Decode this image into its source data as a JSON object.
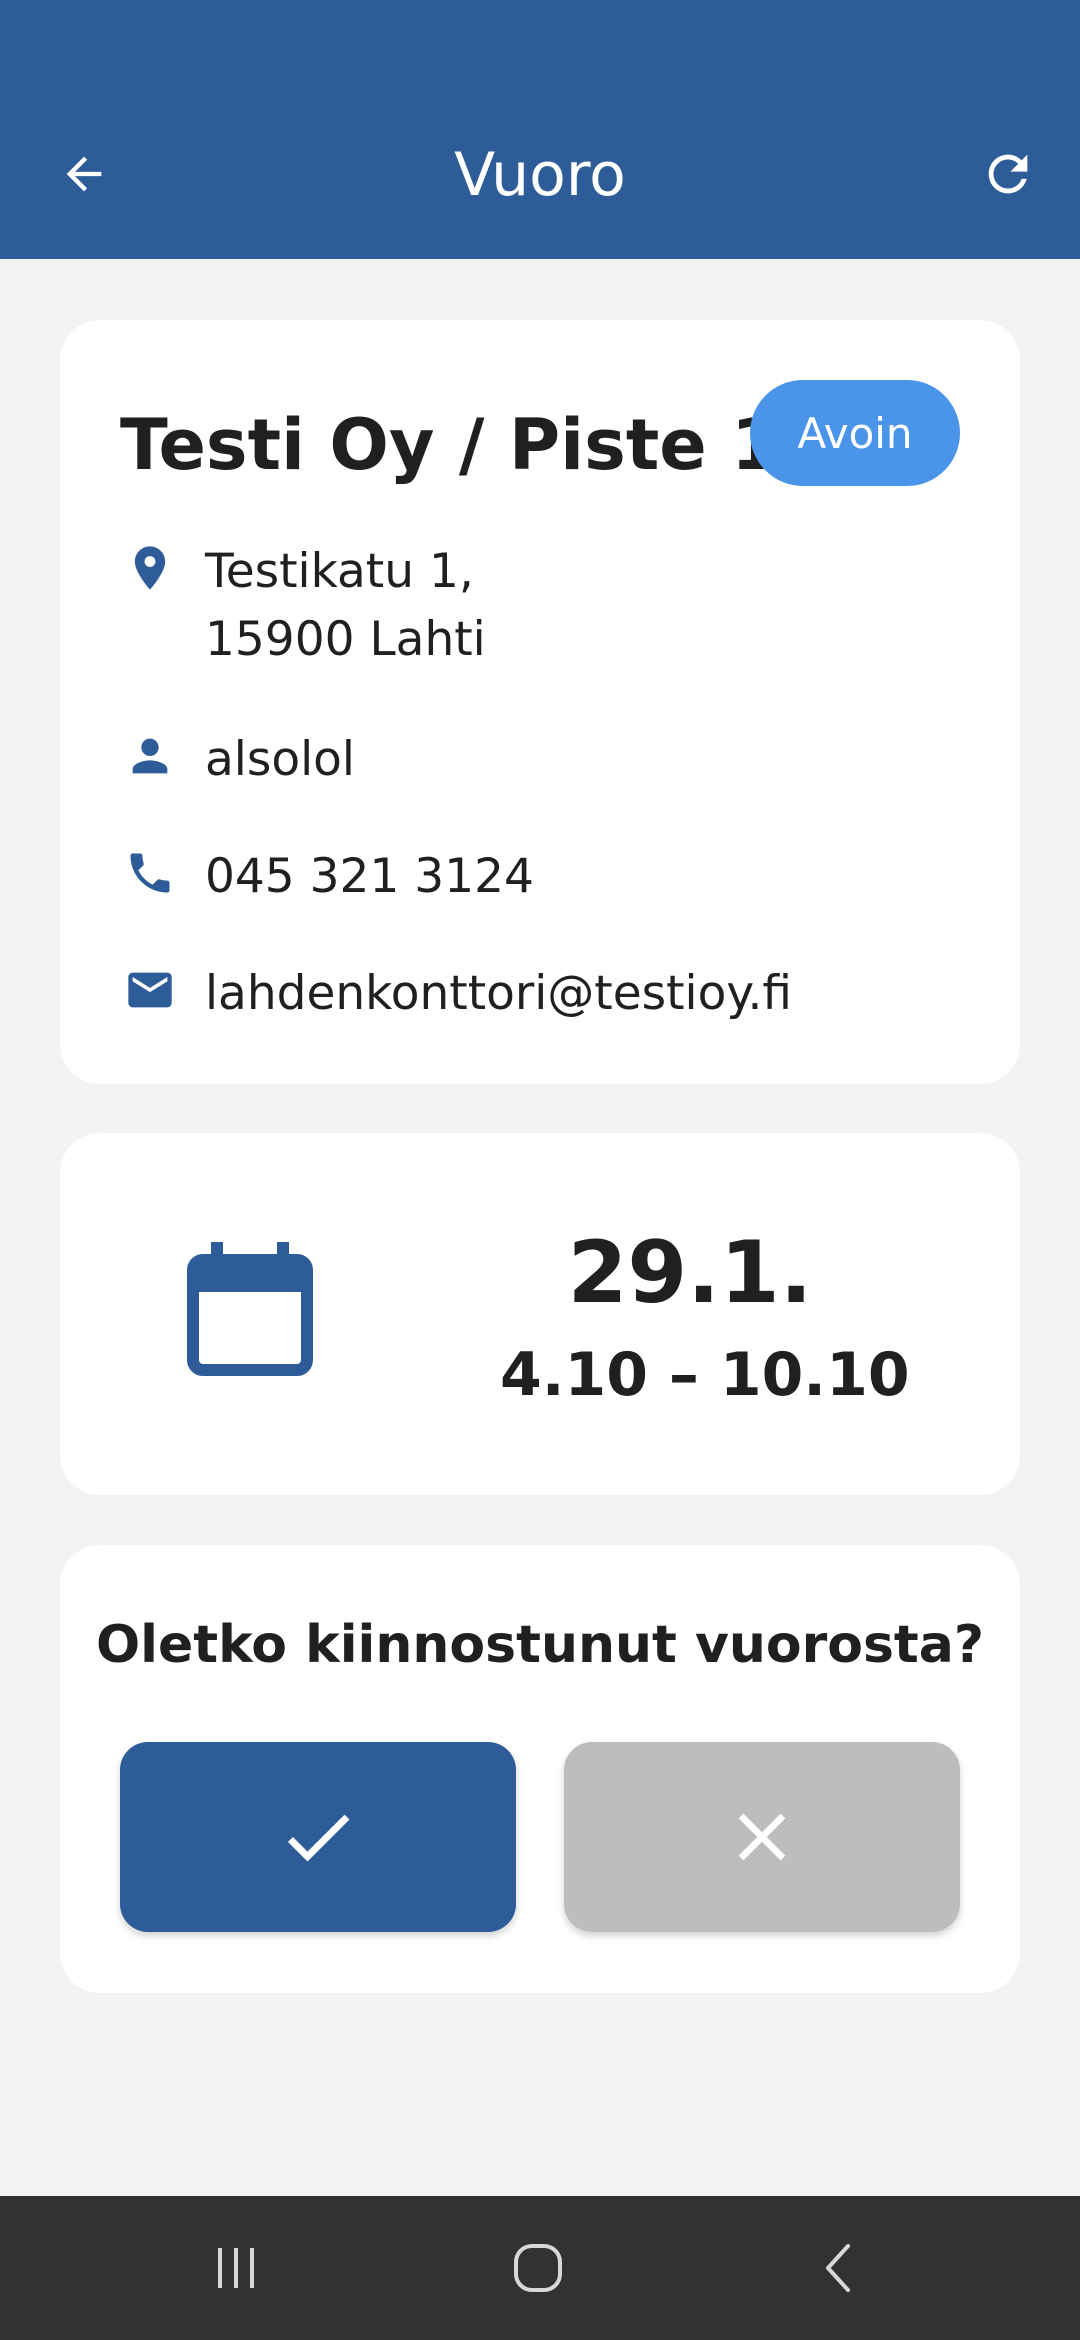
{
  "appbar": {
    "title": "Vuoro",
    "back_icon": "arrow-back-icon",
    "refresh_icon": "refresh-icon",
    "color": "#2d5c99"
  },
  "shift": {
    "place": "Testi Oy / Piste 1",
    "status": "Avoin",
    "status_color": "#4a95ea",
    "address_line1": "Testikatu 1,",
    "address_line2": "15900 Lahti",
    "contact": "alsolol",
    "phone": "045 321 3124",
    "email": "lahdenkonttori@testioy.fi",
    "date": "29.1.",
    "time": "4.10 – 10.10"
  },
  "prompt": {
    "question": "Oletko kiinnostunut vuorosta?",
    "accept_icon": "check-icon",
    "decline_icon": "close-icon",
    "accept_color": "#2d5c99",
    "decline_color": "#bdbdbd"
  },
  "navbar": {
    "recents_icon": "recent-apps-icon",
    "home_icon": "home-icon",
    "back_icon": "back-icon"
  }
}
